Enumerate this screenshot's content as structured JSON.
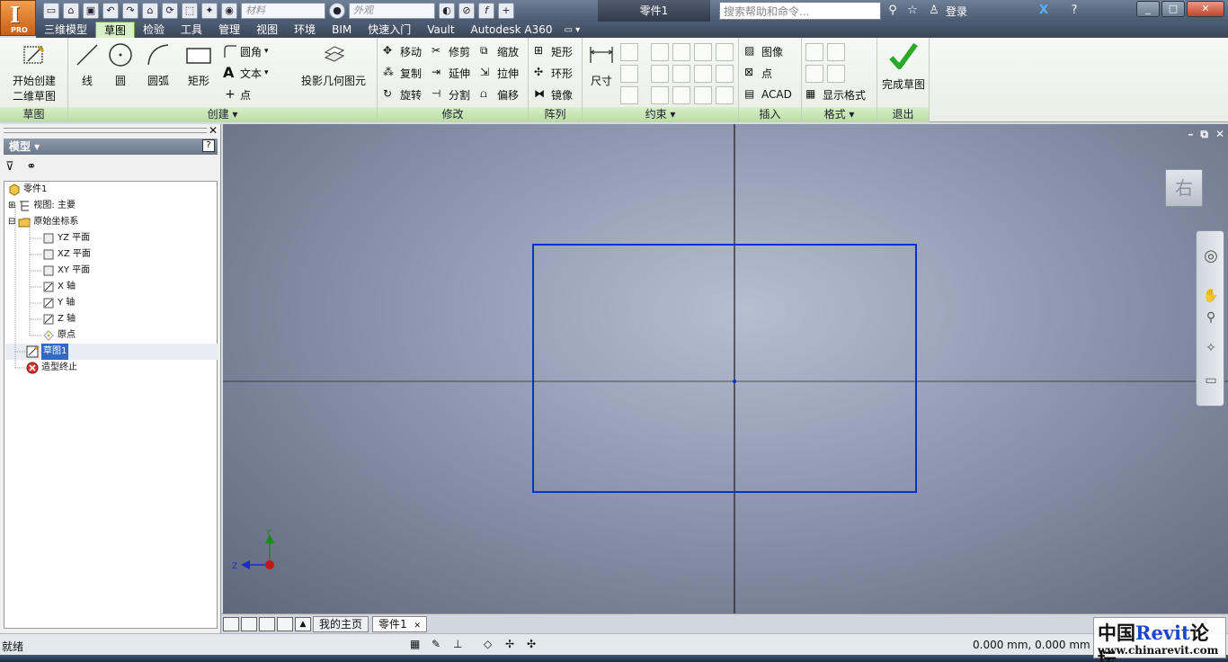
{
  "app": {
    "title": "零件1",
    "logo_letter": "I",
    "logo_sub": "PRO"
  },
  "qat": {
    "material": "材料",
    "appearance": "外观"
  },
  "search": {
    "placeholder": "搜索帮助和命令..."
  },
  "user": {
    "login": "登录"
  },
  "tabs": [
    "三维模型",
    "草图",
    "检验",
    "工具",
    "管理",
    "视图",
    "环境",
    "BIM",
    "快速入门",
    "Vault",
    "Autodesk A360"
  ],
  "active_tab": "草图",
  "ribbon": {
    "sketch_panel": {
      "title": "草图",
      "start_2d_line1": "开始创建",
      "start_2d_line2": "二维草图"
    },
    "create_panel": {
      "title": "创建 ▾",
      "line": "线",
      "circle": "圆",
      "arc": "圆弧",
      "rect": "矩形",
      "fillet": "圆角",
      "text": "文本",
      "point": "点",
      "project": "投影几何图元"
    },
    "modify_panel": {
      "title": "修改",
      "move": "移动",
      "trim": "修剪",
      "scale": "缩放",
      "copy": "复制",
      "extend": "延伸",
      "stretch": "拉伸",
      "rotate": "旋转",
      "split": "分割",
      "offset": "偏移"
    },
    "array_panel": {
      "title": "阵列",
      "rect": "矩形",
      "circular": "环形",
      "mirror": "镜像"
    },
    "constrain_panel": {
      "title": "约束 ▾",
      "dimension": "尺寸"
    },
    "insert_panel": {
      "title": "插入",
      "image": "图像",
      "point": "点",
      "acad": "ACAD"
    },
    "format_panel": {
      "title": "格式 ▾",
      "show_format": "显示格式"
    },
    "exit_panel": {
      "title": "退出",
      "finish": "完成草图"
    }
  },
  "browser": {
    "header": "模型 ▾",
    "help": "?",
    "tree": [
      {
        "label": "零件1",
        "depth": 0
      },
      {
        "label": "视图: 主要",
        "depth": 1
      },
      {
        "label": "原始坐标系",
        "depth": 1
      },
      {
        "label": "YZ 平面",
        "depth": 2
      },
      {
        "label": "XZ 平面",
        "depth": 2
      },
      {
        "label": "XY 平面",
        "depth": 2
      },
      {
        "label": "X 轴",
        "depth": 2
      },
      {
        "label": "Y 轴",
        "depth": 2
      },
      {
        "label": "Z 轴",
        "depth": 2
      },
      {
        "label": "原点",
        "depth": 2
      },
      {
        "label": "草图1",
        "depth": 1
      },
      {
        "label": "造型终止",
        "depth": 1
      }
    ]
  },
  "viewcube": {
    "face": "右"
  },
  "triad": {
    "y": "Y",
    "z": "Z"
  },
  "doc_tabs": {
    "home": "我的主页",
    "part": "零件1"
  },
  "status": {
    "text": "就绪",
    "coords": "0.000 mm, 0.000 mm"
  },
  "watermark": {
    "line1_a": "中国",
    "line1_b": "Revit",
    "line1_c": "论坛",
    "line2": "www.chinarevit.com"
  },
  "colors": {
    "sketch_line": "#0b2fd0",
    "ribbon_green": "#c6e6b2",
    "finish_check": "#2aa82a"
  }
}
